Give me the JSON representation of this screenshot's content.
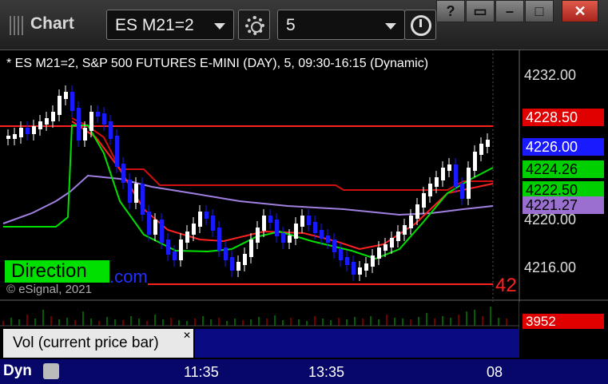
{
  "toolbar": {
    "title": "Chart",
    "symbol": "ES M21=2",
    "interval": "5",
    "window_buttons": [
      "?",
      "▭",
      "–",
      "□",
      "✕"
    ]
  },
  "chart": {
    "legend": "* ES M21=2, S&P 500 FUTURES E-MINI (DAY), 5, 09:30-16:15 (Dynamic)",
    "watermark": "Direction",
    "watermark_suffix": ".com",
    "copyright": "© eSignal, 2021",
    "edge_label": "42",
    "price_ticks": [
      "4232.00",
      "4220.00",
      "4216.00"
    ],
    "badges": [
      {
        "text": "4228.50",
        "color": "#e00000"
      },
      {
        "text": "4226.00",
        "color": "#1a1aff"
      },
      {
        "text": "4224.26",
        "color": "#00d000"
      },
      {
        "text": "4222.50",
        "color": "#00d000"
      },
      {
        "text": "4221.27",
        "color": "#9a6fd0"
      }
    ]
  },
  "volume": {
    "label": "Vol (current price bar)",
    "badge": "3952"
  },
  "time_axis": {
    "mode": "Dyn",
    "labels": [
      "11:35",
      "13:35",
      "08"
    ]
  },
  "colors": {
    "up_candle": "#ffffff",
    "down_candle": "#1a1aff",
    "red_line": "#ff2020",
    "green_line": "#00e000",
    "purple_line": "#a080e0"
  }
}
